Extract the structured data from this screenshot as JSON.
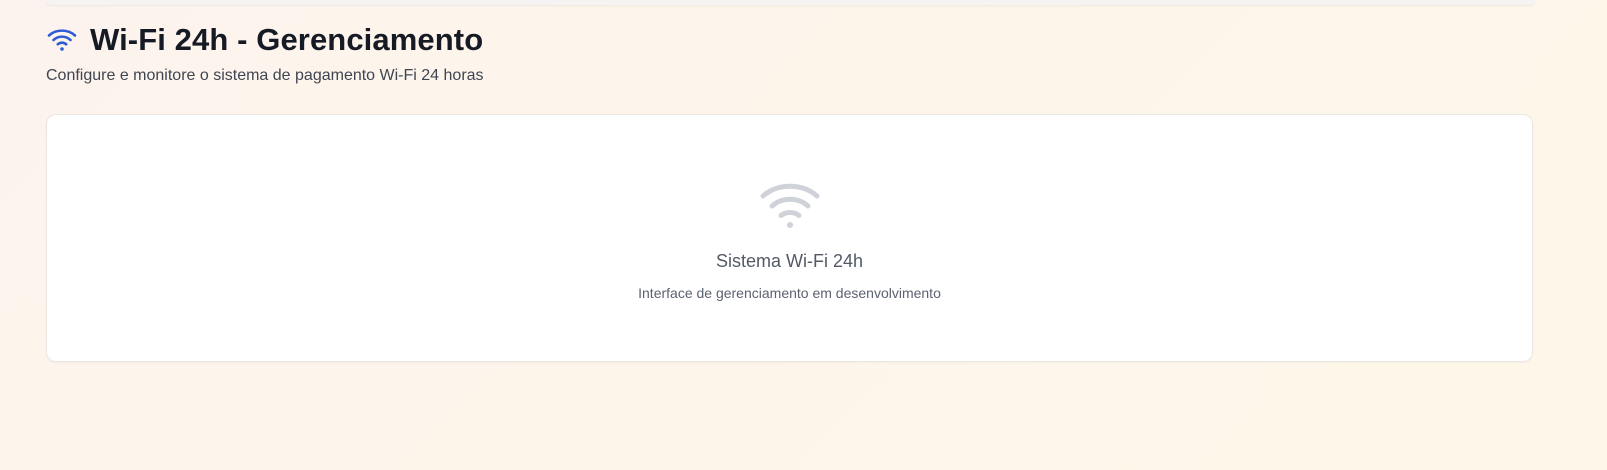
{
  "header": {
    "title": "Wi-Fi 24h - Gerenciamento",
    "subtitle": "Configure e monitore o sistema de pagamento Wi-Fi 24 horas",
    "icon": "wifi-icon"
  },
  "card": {
    "icon": "wifi-icon",
    "title": "Sistema Wi-Fi 24h",
    "description": "Interface de gerenciamento em desenvolvimento"
  },
  "colors": {
    "accent": "#2f5bd6",
    "icon_muted": "#cfd2d8",
    "title": "#151a24",
    "background": "#fdf4ec"
  }
}
